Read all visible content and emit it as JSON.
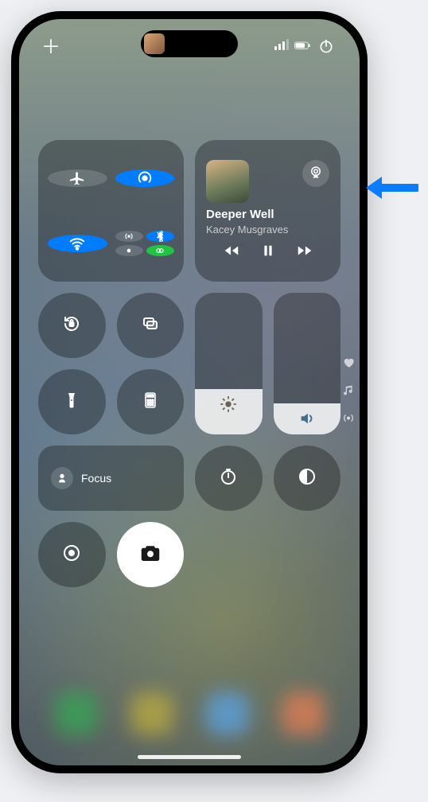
{
  "status": {
    "add_glyph": "＋"
  },
  "now_playing": {
    "title": "Deeper Well",
    "artist": "Kacey Musgraves"
  },
  "focus": {
    "label": "Focus"
  },
  "sliders": {
    "brightness_percent": 32,
    "volume_percent": 22
  },
  "dock_colors": [
    "#3fa05a",
    "#b6a84b",
    "#5fa0d8",
    "#d87f5a"
  ]
}
